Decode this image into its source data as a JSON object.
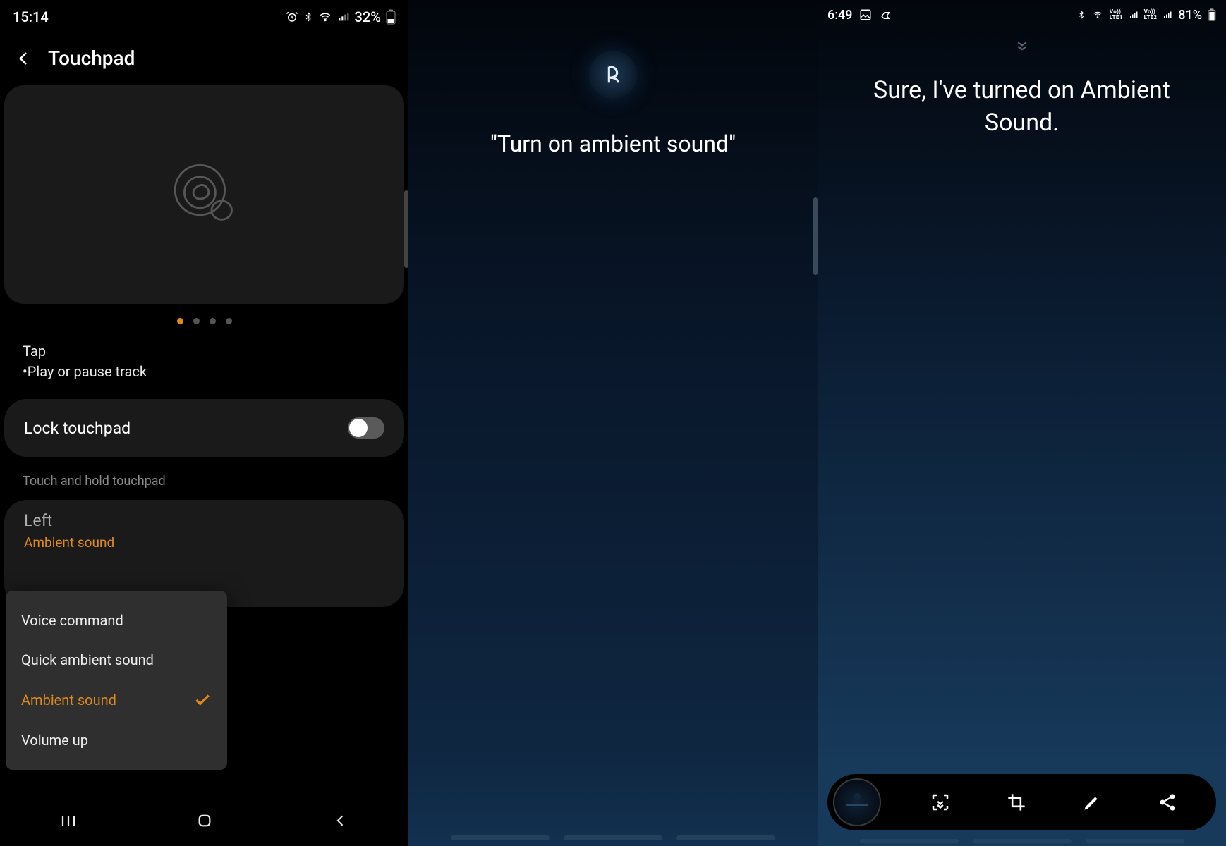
{
  "screen1": {
    "status": {
      "time": "15:14",
      "battery": "32%"
    },
    "title": "Touchpad",
    "pager_active": 0,
    "pager_count": 4,
    "tap_heading": "Tap",
    "tap_action": "•Play or pause track",
    "lock_label": "Lock touchpad",
    "lock_on": false,
    "section_label": "Touch and hold touchpad",
    "left_title": "Left",
    "left_value": "Ambient sound",
    "popup": {
      "items": [
        "Voice command",
        "Quick ambient sound",
        "Ambient sound",
        "Volume up"
      ],
      "selected_index": 2
    }
  },
  "screen2": {
    "voice_text": "\"Turn on ambient sound\""
  },
  "screen3": {
    "status": {
      "time": "6:49",
      "battery": "81%",
      "lte1": "VoD\nLTE1",
      "lte2": "VoD\nLTE2"
    },
    "response": "Sure, I've turned on Ambient Sound."
  }
}
